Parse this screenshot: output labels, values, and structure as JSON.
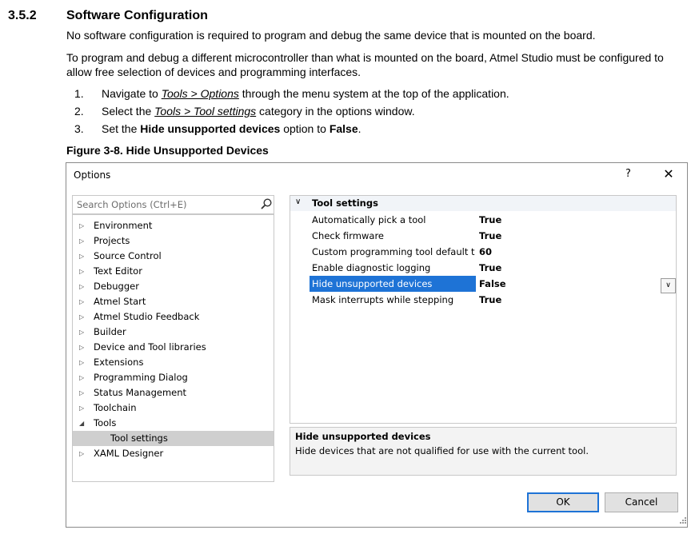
{
  "section": {
    "number": "3.5.2",
    "title": "Software Configuration",
    "para1": "No software configuration is required to program and debug the same device that is mounted on the board.",
    "para2": "To program and debug a different microcontroller than what is mounted on the board, Atmel Studio must be configured to allow free selection of devices and programming interfaces.",
    "steps": [
      {
        "num": "1.",
        "pre": "Navigate to ",
        "link": "Tools > Options",
        "post": " through the menu system at the top of the application."
      },
      {
        "num": "2.",
        "pre": "Select the ",
        "link": "Tools > Tool settings",
        "post": " category in the options window."
      },
      {
        "num": "3.",
        "pre": "Set the ",
        "bold1": "Hide unsupported devices",
        "mid": " option to ",
        "bold2": "False",
        "post": "."
      }
    ],
    "figure_caption": "Figure 3-8.  Hide Unsupported Devices"
  },
  "dialog": {
    "title": "Options",
    "help": "?",
    "close": "✕",
    "search_placeholder": "Search Options (Ctrl+E)",
    "tree": [
      {
        "label": "Environment",
        "arrow": "▷"
      },
      {
        "label": "Projects",
        "arrow": "▷"
      },
      {
        "label": "Source Control",
        "arrow": "▷"
      },
      {
        "label": "Text Editor",
        "arrow": "▷"
      },
      {
        "label": "Debugger",
        "arrow": "▷"
      },
      {
        "label": "Atmel Start",
        "arrow": "▷"
      },
      {
        "label": "Atmel Studio Feedback",
        "arrow": "▷"
      },
      {
        "label": "Builder",
        "arrow": "▷"
      },
      {
        "label": "Device and Tool libraries",
        "arrow": "▷"
      },
      {
        "label": "Extensions",
        "arrow": "▷"
      },
      {
        "label": "Programming Dialog",
        "arrow": "▷"
      },
      {
        "label": "Status Management",
        "arrow": "▷"
      },
      {
        "label": "Toolchain",
        "arrow": "▷"
      },
      {
        "label": "Tools",
        "arrow": "◢"
      },
      {
        "label": "Tool settings",
        "arrow": ""
      },
      {
        "label": "XAML Designer",
        "arrow": "▷"
      }
    ],
    "category": "Tool settings",
    "category_chevron": "∨",
    "properties": [
      {
        "name": "Automatically pick a tool",
        "value": "True"
      },
      {
        "name": "Check firmware",
        "value": "True"
      },
      {
        "name": "Custom programming tool default timeout",
        "value": "60"
      },
      {
        "name": "Enable diagnostic logging",
        "value": "True"
      },
      {
        "name": "Hide unsupported devices",
        "value": "False"
      },
      {
        "name": "Mask interrupts while stepping",
        "value": "True"
      }
    ],
    "dropdown_glyph": "∨",
    "description_title": "Hide unsupported devices",
    "description_text": "Hide devices that are not qualified for use with the current tool.",
    "ok_label": "OK",
    "cancel_label": "Cancel",
    "selection_color": "#1e73d6"
  }
}
